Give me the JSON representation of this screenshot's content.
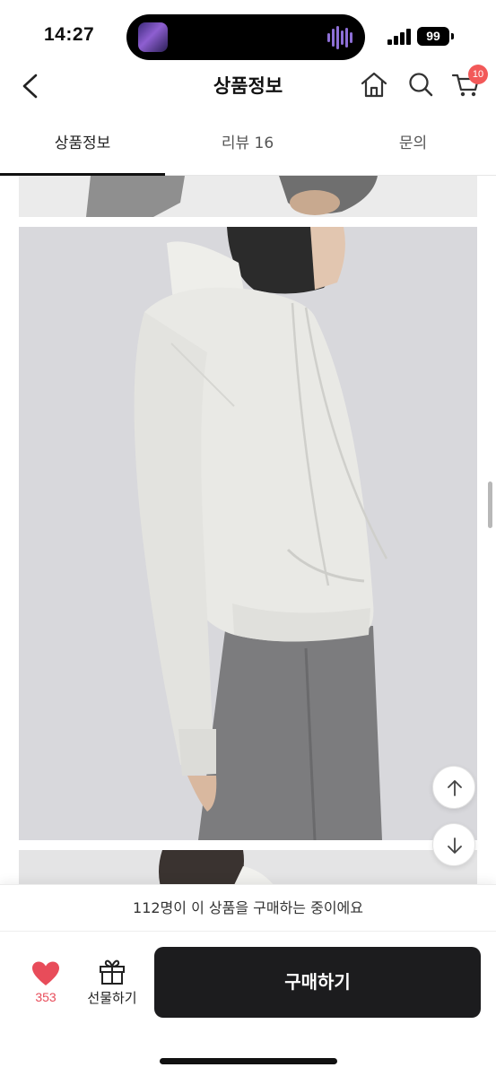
{
  "status_bar": {
    "time": "14:27",
    "battery": "99"
  },
  "header": {
    "title": "상품정보",
    "back_icon": "chevron-left-icon",
    "home_icon": "home-icon",
    "search_icon": "search-icon",
    "cart_icon": "cart-icon",
    "cart_badge": "10"
  },
  "tabs": [
    {
      "label": "상품정보",
      "active": true
    },
    {
      "label": "리뷰 16",
      "active": false
    },
    {
      "label": "문의",
      "active": false
    }
  ],
  "floating": {
    "scroll_up_icon": "arrow-up-icon",
    "scroll_down_icon": "arrow-down-icon"
  },
  "banner": {
    "text": "112명이 이 상품을 구매하는 중이에요"
  },
  "bottom_bar": {
    "like_icon": "heart-icon",
    "like_count": "353",
    "gift_icon": "gift-icon",
    "gift_label": "선물하기",
    "buy_label": "구매하기"
  },
  "colors": {
    "accent_red": "#e84c5a",
    "badge_red": "#f25959",
    "buy_button": "#1c1c1e"
  }
}
